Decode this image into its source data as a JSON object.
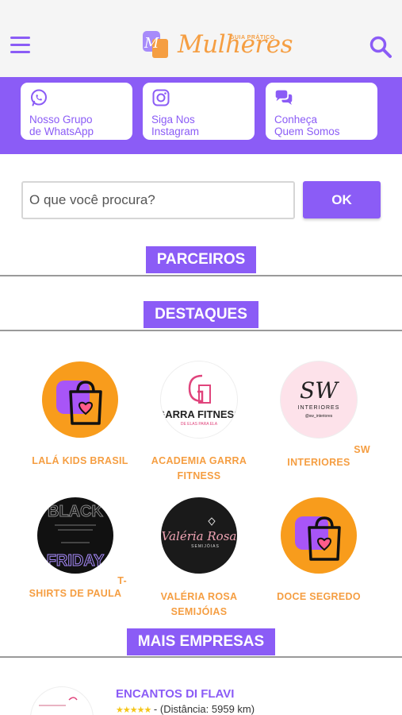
{
  "header": {
    "logo_subtitle": "GUIA PRÁTICO",
    "logo_title": "Mulheres"
  },
  "social": [
    {
      "icon": "whatsapp-icon",
      "line1": "Nosso Grupo",
      "line2": "de WhatsApp"
    },
    {
      "icon": "instagram-icon",
      "line1": "Siga Nos",
      "line2": "Instagram"
    },
    {
      "icon": "chat-icon",
      "line1": "Conheça",
      "line2": "Quem Somos"
    }
  ],
  "search": {
    "placeholder": "O que você procura?",
    "button_label": "OK"
  },
  "sections": {
    "partners": "PARCEIROS",
    "highlights": "DESTAQUES",
    "more": "MAIS EMPRESAS"
  },
  "featured": [
    {
      "name_line1": "LALÁ KIDS BRASIL",
      "name_line2": "",
      "logo": "bag-icon"
    },
    {
      "name_line1": "ACADEMIA GARRA",
      "name_line2": "FITNESS",
      "logo_text": "GARRA FITNESS",
      "logo_tagline": "DE ELAS PARA ELA"
    },
    {
      "name_line0": "SW",
      "name_line1": "INTERIORES",
      "name_line2": "",
      "logo_text": "SW",
      "logo_sub": "INTERIORES",
      "logo_handle": "@sw_interiores"
    },
    {
      "name_line0": "T-",
      "name_line1": "SHIRTS DE PAULA",
      "name_line2": "",
      "logo_text1": "BLACK",
      "logo_text2": "FRIDAY"
    },
    {
      "name_line1": "VALÉRIA ROSA",
      "name_line2": "SEMIJÓIAS",
      "logo_text": "Valéria Rosa",
      "logo_sub": "SEMIJÓIAS"
    },
    {
      "name_line1": "DOCE SEGREDO",
      "name_line2": "",
      "logo": "bag-icon"
    }
  ],
  "company": {
    "name": "ENCANTOS DI FLAVI",
    "stars": "★★★★★",
    "distance": " - (Distância: 5959 km)"
  },
  "colors": {
    "brand_purple": "#8B5CF6",
    "brand_orange": "#F59E42"
  }
}
